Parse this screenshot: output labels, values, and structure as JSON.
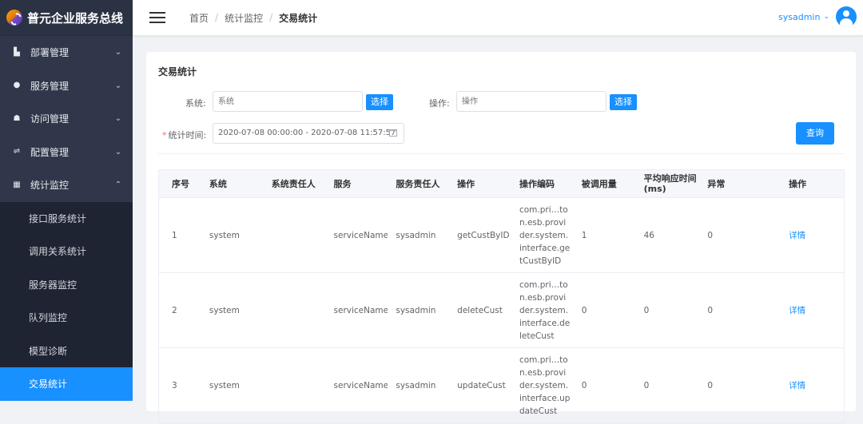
{
  "brand": {
    "title": "普元企业服务总线"
  },
  "sidebar": {
    "items": [
      {
        "label": "部署管理",
        "icon": "deploy-icon",
        "expanded": false
      },
      {
        "label": "服务管理",
        "icon": "service-icon",
        "expanded": false
      },
      {
        "label": "访问管理",
        "icon": "access-icon",
        "expanded": false
      },
      {
        "label": "配置管理",
        "icon": "config-icon",
        "expanded": false
      },
      {
        "label": "统计监控",
        "icon": "monitor-icon",
        "expanded": true
      }
    ],
    "subitems": [
      {
        "label": "接口服务统计",
        "active": false
      },
      {
        "label": "调用关系统计",
        "active": false
      },
      {
        "label": "服务器监控",
        "active": false
      },
      {
        "label": "队列监控",
        "active": false
      },
      {
        "label": "模型诊断",
        "active": false
      },
      {
        "label": "交易统计",
        "active": true
      }
    ]
  },
  "header": {
    "breadcrumb": [
      "首页",
      "统计监控",
      "交易统计"
    ],
    "separator": "/",
    "user": "sysadmin"
  },
  "page": {
    "title": "交易统计",
    "filters": {
      "system_label": "系统:",
      "system_placeholder": "系统",
      "operation_label": "操作:",
      "operation_placeholder": "操作",
      "select_button": "选择",
      "time_required_mark": "*",
      "time_label": "统计时间:",
      "time_value": "2020-07-08 00:00:00 - 2020-07-08 11:57:57",
      "query_button": "查询"
    }
  },
  "table": {
    "headers": [
      "序号",
      "系统",
      "系统责任人",
      "服务",
      "服务责任人",
      "操作",
      "操作编码",
      "被调用量",
      "平均响应时间(ms)",
      "异常",
      "操作"
    ],
    "rows": [
      {
        "no": "1",
        "system": "system",
        "system_owner": "",
        "service": "serviceName",
        "service_owner": "sysadmin",
        "operation": "getCustByID",
        "code": "com.pri…ton.esb.provider.system.interface.getCustByID",
        "calls": "1",
        "avg_ms": "46",
        "errors": "0",
        "action": "详情"
      },
      {
        "no": "2",
        "system": "system",
        "system_owner": "",
        "service": "serviceName",
        "service_owner": "sysadmin",
        "operation": "deleteCust",
        "code": "com.pri…ton.esb.provider.system.interface.deleteCust",
        "calls": "0",
        "avg_ms": "0",
        "errors": "0",
        "action": "详情"
      },
      {
        "no": "3",
        "system": "system",
        "system_owner": "",
        "service": "serviceName",
        "service_owner": "sysadmin",
        "operation": "updateCust",
        "code": "com.pri…ton.esb.provider.system.interface.updateCust",
        "calls": "0",
        "avg_ms": "0",
        "errors": "0",
        "action": "详情"
      }
    ]
  },
  "colors": {
    "accent": "#1890ff",
    "sidebar_bg": "#30374a",
    "required": "#f56c6c"
  }
}
